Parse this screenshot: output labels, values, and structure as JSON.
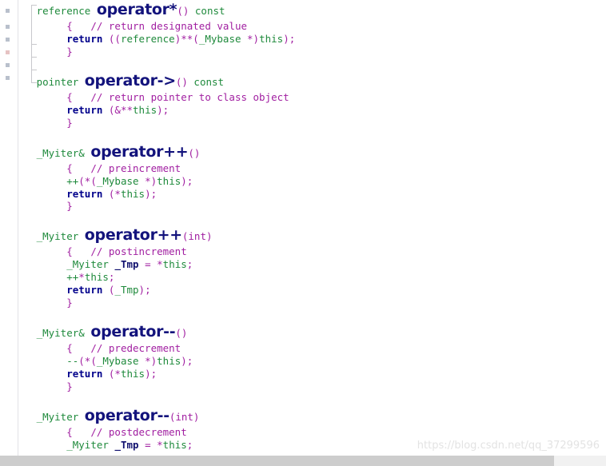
{
  "editor": {
    "language": "cpp",
    "colors": {
      "type": "#1f8a3c",
      "keyword": "#00008b",
      "punctuation": "#a11fa1",
      "comment": "#a11fa1",
      "variable": "#11116f",
      "highlight": "#13137c",
      "background": "#ffffff",
      "gutter_rule": "#e2e2e6",
      "fold_bracket": "#c8c8cc",
      "scrollbar_track": "#f1f1f1",
      "scrollbar_thumb": "#cdcdcd",
      "watermark": "#e3e3e3"
    }
  },
  "watermark": {
    "text": "https://blog.csdn.net/qq_37299596"
  },
  "scrollbar": {
    "orientation": "horizontal",
    "thumb_label": "horizontal-scroll-thumb"
  },
  "gutter": {
    "marker_label": "gutter-change-marker"
  },
  "code_blocks": [
    {
      "id": "operator-deref",
      "signature": {
        "return_type": "reference ",
        "name": "operator*",
        "params": "() ",
        "qualifier": "const"
      },
      "lines": [
        {
          "indent": 8,
          "brace": "{",
          "gap": "   ",
          "comment": "// return designated value"
        },
        {
          "indent": 8,
          "keyword": "return",
          "rest": " ((reference)**(_Mybase *)this);"
        },
        {
          "indent": 8,
          "brace": "}"
        }
      ]
    },
    {
      "id": "operator-arrow",
      "signature": {
        "return_type": "pointer ",
        "name": "operator->",
        "params": "() ",
        "qualifier": "const"
      },
      "lines": [
        {
          "indent": 8,
          "brace": "{",
          "gap": "   ",
          "comment": "// return pointer to class object"
        },
        {
          "indent": 8,
          "keyword": "return",
          "rest": " (&**this);"
        },
        {
          "indent": 8,
          "brace": "}"
        }
      ]
    },
    {
      "id": "operator-preincrement",
      "signature": {
        "return_type": "_Myiter& ",
        "name": "operator++",
        "params": "()",
        "qualifier": ""
      },
      "lines": [
        {
          "indent": 8,
          "brace": "{",
          "gap": "   ",
          "comment": "// preincrement"
        },
        {
          "indent": 8,
          "expr": "++(*(_Mybase *)this);"
        },
        {
          "indent": 8,
          "keyword": "return",
          "rest": " (*this);"
        },
        {
          "indent": 8,
          "brace": "}"
        }
      ]
    },
    {
      "id": "operator-postincrement",
      "signature": {
        "return_type": "_Myiter ",
        "name": "operator++",
        "params": "(int)",
        "qualifier": ""
      },
      "lines": [
        {
          "indent": 8,
          "brace": "{",
          "gap": "   ",
          "comment": "// postincrement"
        },
        {
          "indent": 8,
          "decl_type": "_Myiter ",
          "decl_var": "_Tmp",
          "decl_rest": " = *this;"
        },
        {
          "indent": 8,
          "expr": "++*this;"
        },
        {
          "indent": 8,
          "keyword": "return",
          "rest": " (_Tmp);"
        },
        {
          "indent": 8,
          "brace": "}"
        }
      ]
    },
    {
      "id": "operator-predecrement",
      "signature": {
        "return_type": "_Myiter& ",
        "name": "operator--",
        "params": "()",
        "qualifier": ""
      },
      "lines": [
        {
          "indent": 8,
          "brace": "{",
          "gap": "   ",
          "comment": "// predecrement"
        },
        {
          "indent": 8,
          "expr": "--(*(_Mybase *)this);"
        },
        {
          "indent": 8,
          "keyword": "return",
          "rest": " (*this);"
        },
        {
          "indent": 8,
          "brace": "}"
        }
      ]
    },
    {
      "id": "operator-postdecrement",
      "signature": {
        "return_type": "_Myiter ",
        "name": "operator--",
        "params": "(int)",
        "qualifier": ""
      },
      "lines": [
        {
          "indent": 8,
          "brace": "{",
          "gap": "   ",
          "comment": "// postdecrement"
        },
        {
          "indent": 8,
          "decl_type": "_Myiter ",
          "decl_var": "_Tmp",
          "decl_rest": " = *this;"
        }
      ]
    }
  ]
}
